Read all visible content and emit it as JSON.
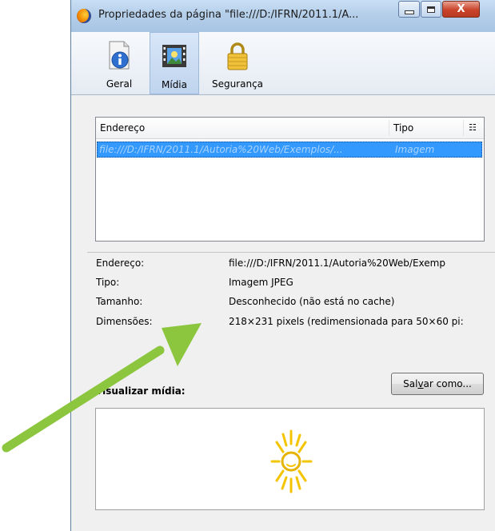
{
  "window": {
    "title": "Propriedades da página \"file:///D:/IFRN/2011.1/A...",
    "close_symbol": "X"
  },
  "toolbar": {
    "tabs": [
      {
        "label": "Geral",
        "icon": "info-icon"
      },
      {
        "label": "Mídia",
        "icon": "media-icon"
      },
      {
        "label": "Segurança",
        "icon": "lock-icon"
      }
    ],
    "selected": "Mídia"
  },
  "media_list": {
    "columns": [
      "Endereço",
      "Tipo"
    ],
    "rows": [
      {
        "address": "file:///D:/IFRN/2011.1/Autoria%20Web/Exemplos/...",
        "type": "Imagem"
      }
    ]
  },
  "details": {
    "address_label": "Endereço:",
    "address_value": "file:///D:/IFRN/2011.1/Autoria%20Web/Exemp",
    "type_label": "Tipo:",
    "type_value": "Imagem JPEG",
    "size_label": "Tamanho:",
    "size_value": "Desconhecido (não está no cache)",
    "dims_label": "Dimensões:",
    "dims_value": "218×231 pixels (redimensionada para 50×60 pi:"
  },
  "save_button": {
    "label_pre": "Sal",
    "label_accel": "v",
    "label_post": "ar como..."
  },
  "preview": {
    "label": "Visualizar mídia:"
  },
  "colors": {
    "arrow": "#8cc63f",
    "selection": "#3399ff",
    "sun": "#f5c400"
  }
}
